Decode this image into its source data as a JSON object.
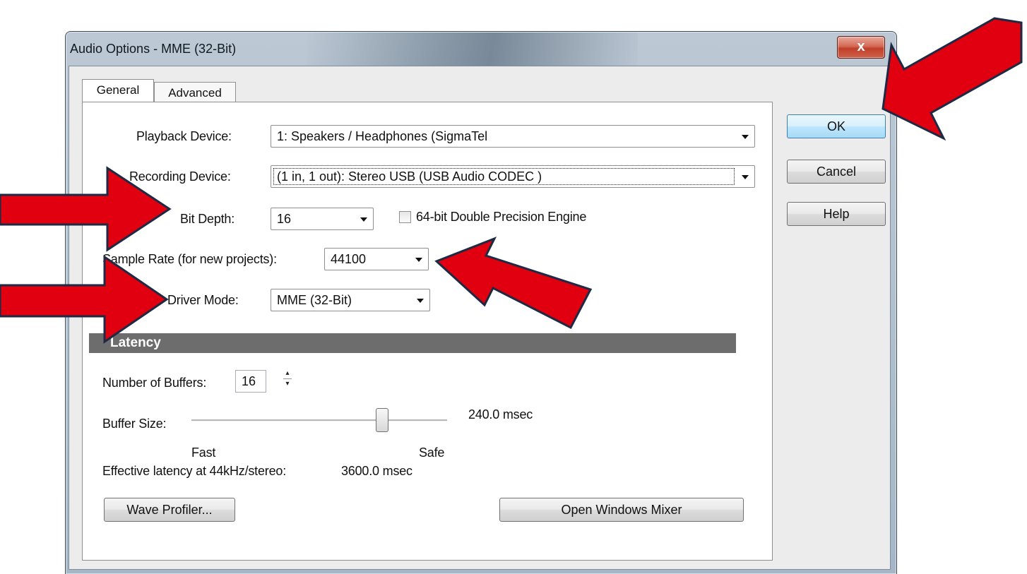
{
  "window": {
    "title": "Audio Options - MME (32-Bit)",
    "close_glyph": "x"
  },
  "tabs": [
    {
      "label": "General"
    },
    {
      "label": "Advanced"
    }
  ],
  "buttons": {
    "ok": "OK",
    "cancel": "Cancel",
    "help": "Help",
    "wave_profiler": "Wave Profiler...",
    "open_mixer": "Open Windows Mixer"
  },
  "general": {
    "playback_label": "Playback Device:",
    "playback_value": "1: Speakers / Headphones (SigmaTel",
    "recording_label": "Recording Device:",
    "recording_value": "(1 in, 1 out): Stereo USB (USB Audio CODEC )",
    "bit_depth_label": "Bit Depth:",
    "bit_depth_value": "16",
    "double_precision_label": "64-bit Double Precision Engine",
    "double_precision_checked": false,
    "sample_rate_label": "Sample Rate (for new projects):",
    "sample_rate_value": "44100",
    "driver_mode_label": "Driver Mode:",
    "driver_mode_value": "MME (32-Bit)"
  },
  "latency": {
    "section_title": "Latency",
    "buffers_label": "Number of Buffers:",
    "buffers_value": "16",
    "buffer_size_label": "Buffer Size:",
    "buffer_size_value": "240.0 msec",
    "slider_position": 0.76,
    "fast_label": "Fast",
    "safe_label": "Safe",
    "effective_label": "Effective latency at 44kHz/stereo:",
    "effective_value": "3600.0 msec"
  },
  "colors": {
    "annotation_arrow": "#e0000f",
    "section_bar": "#6d6d6d"
  },
  "annotations": [
    "arrow-to-ok",
    "arrow-to-bit-depth",
    "arrow-to-driver-mode",
    "arrow-to-sample-rate"
  ]
}
